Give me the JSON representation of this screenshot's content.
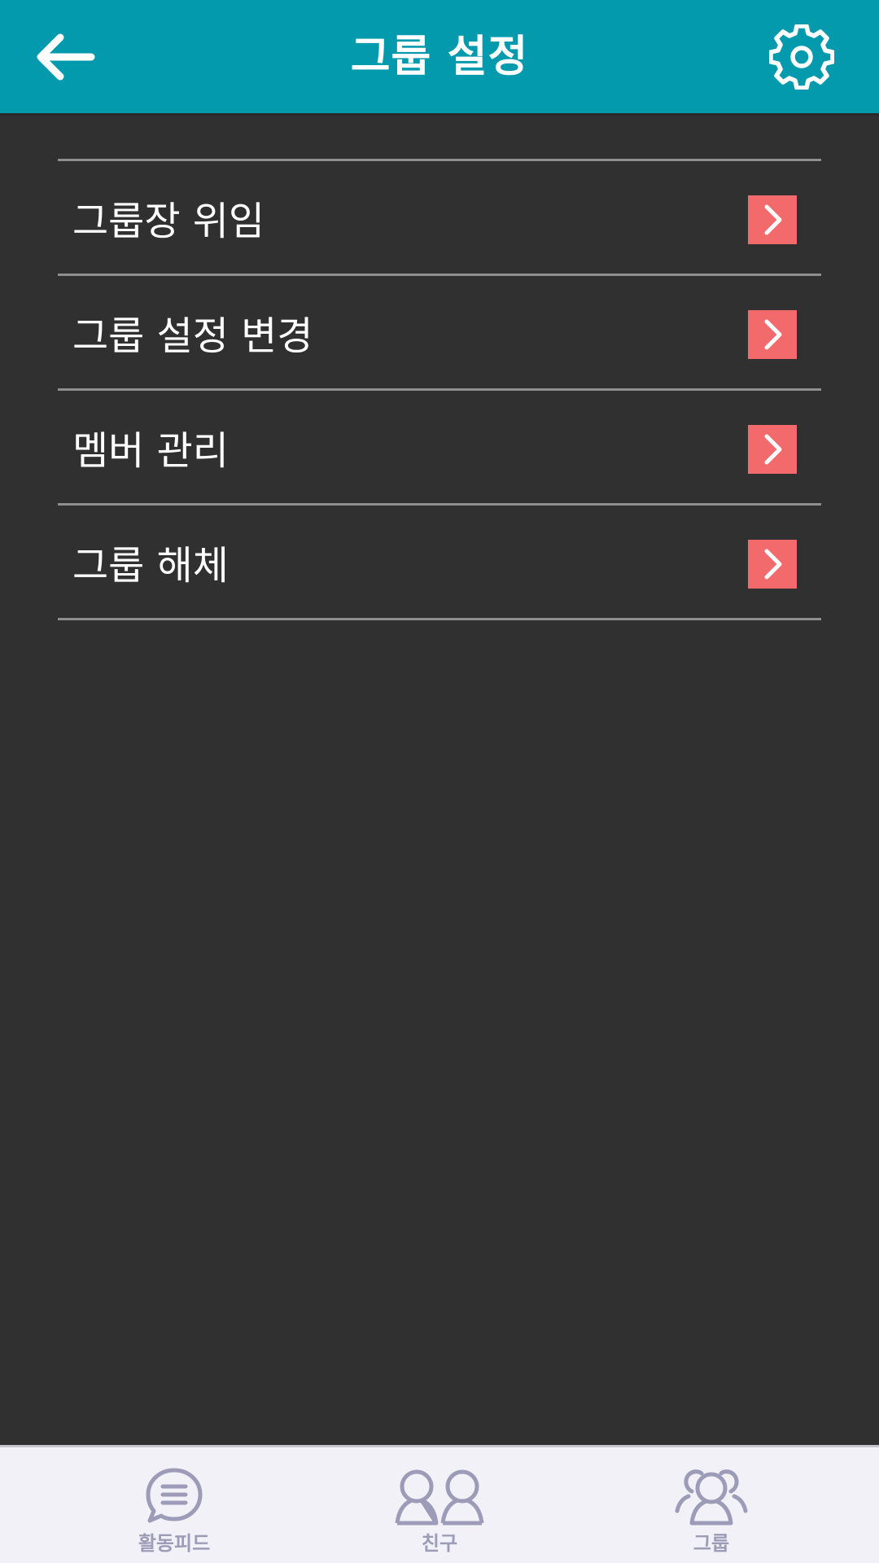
{
  "header": {
    "title": "그룹 설정",
    "back_icon": "arrow-left-icon",
    "settings_icon": "gear-icon",
    "background_color": "#049aae"
  },
  "menu": {
    "items": [
      {
        "label": "그룹장 위임",
        "icon": "chevron-right-icon"
      },
      {
        "label": "그룹 설정 변경",
        "icon": "chevron-right-icon"
      },
      {
        "label": "멤버 관리",
        "icon": "chevron-right-icon"
      },
      {
        "label": "그룹 해체",
        "icon": "chevron-right-icon"
      }
    ],
    "chevron_color": "#f26a6b"
  },
  "tabbar": {
    "tabs": [
      {
        "label": "활동피드",
        "icon": "chat-bubble-icon"
      },
      {
        "label": "친구",
        "icon": "friends-icon"
      },
      {
        "label": "그룹",
        "icon": "group-icon"
      }
    ],
    "icon_color": "#9d9cb8"
  }
}
